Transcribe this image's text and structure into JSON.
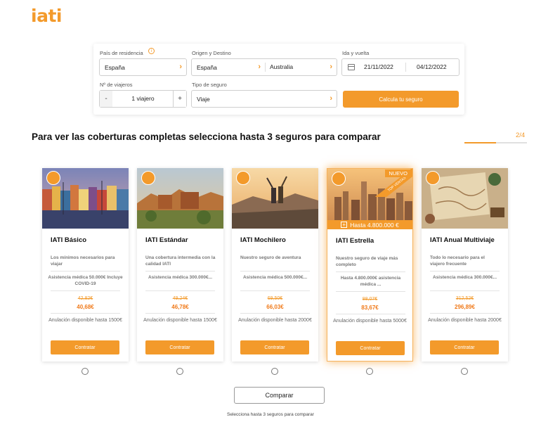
{
  "brand": {
    "logo": "iati",
    "accent": "#f39a2b"
  },
  "search": {
    "residencia_label": "País de residencia",
    "residencia_value": "España",
    "origen_label": "Origen y Destino",
    "origen_value": "España",
    "destino_value": "Australia",
    "fechas_label": "Ida y vuelta",
    "ida_value": "21/11/2022",
    "vuelta_value": "04/12/2022",
    "viajeros_label": "Nº de viajeros",
    "viajeros_value": "1 viajero",
    "minus": "-",
    "plus": "+",
    "tipo_label": "Tipo de seguro",
    "tipo_value": "Viaje",
    "calc_button": "Calcula tu seguro"
  },
  "headline": "Para ver las coberturas completas selecciona hasta 3 seguros para comparar",
  "pager": {
    "label": "2/4",
    "progress": 0.5
  },
  "cards": [
    {
      "title": "IATI Básico",
      "desc": "Los mínimos necesarios para viajar",
      "coverage": "Asistencia médica 50.000€ Incluye COVID-19",
      "old_price": "42,82€",
      "new_price": "40,68€",
      "cancel": "Anulación disponible hasta 1500€",
      "cta": "Contratar"
    },
    {
      "title": "IATI Estándar",
      "desc": "Una cobertura intermedia con la calidad IATI",
      "coverage": "Asistencia médica 300.000€...",
      "old_price": "49,24€",
      "new_price": "46,78€",
      "cancel": "Anulación disponible hasta 1500€",
      "cta": "Contratar"
    },
    {
      "title": "IATI Mochilero",
      "desc": "Nuestro seguro de aventura",
      "coverage": "Asistencia médica 500.000€...",
      "old_price": "69,50€",
      "new_price": "66,03€",
      "cancel": "Anulación disponible hasta 2000€",
      "cta": "Contratar"
    },
    {
      "title": "IATI Estrella",
      "desc": "Nuestro seguro de viaje más completo",
      "coverage": "Hasta 4.800.000€ asistencia médica ...",
      "old_price": "88,07€",
      "new_price": "83,67€",
      "cancel": "Anulación disponible hasta 5000€",
      "cta": "Contratar",
      "nuevo": "NUEVO",
      "ribbon": "TOP VENTAS",
      "hasta": "Hasta 4.800.000 €"
    },
    {
      "title": "IATI Anual Multiviaje",
      "desc": "Todo lo necesario para el viajero frecuente",
      "coverage": "Asistencia médica 300.000€...",
      "old_price": "312,52€",
      "new_price": "296,89€",
      "cancel": "Anulación disponible hasta 2000€",
      "cta": "Contratar"
    }
  ],
  "compare_button": "Comparar",
  "helper": "Selecciona hasta 3 seguros para comparar"
}
